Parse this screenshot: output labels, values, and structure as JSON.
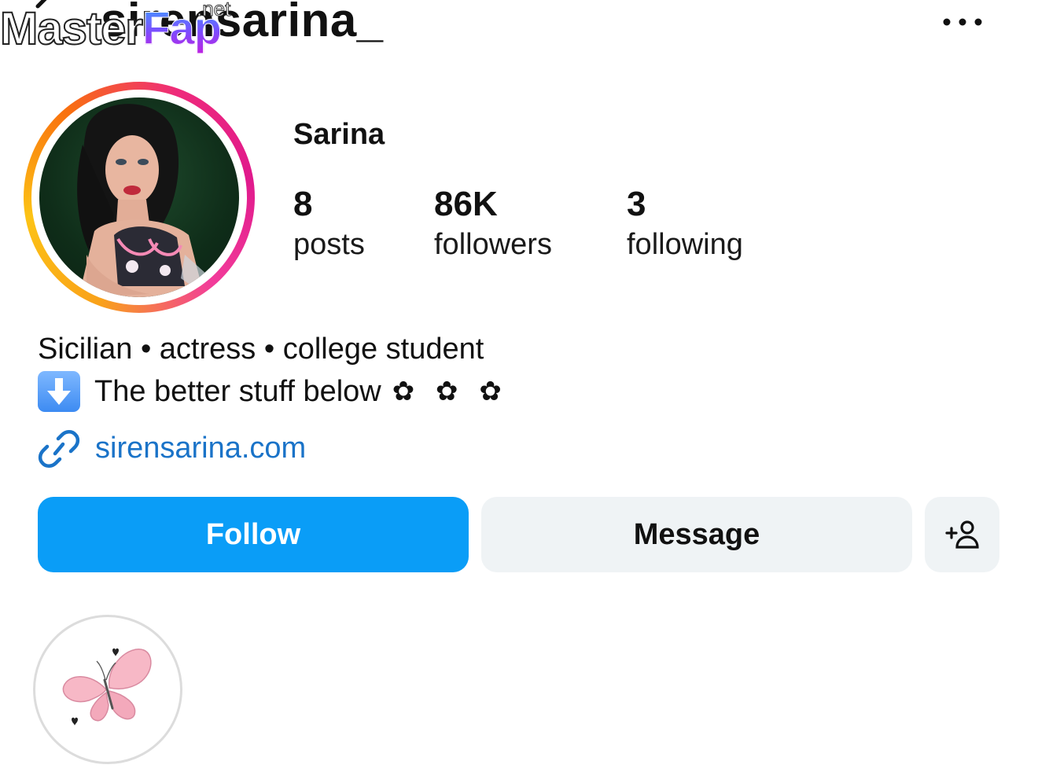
{
  "header": {
    "username": "sirensarina_",
    "watermark_main": "Master",
    "watermark_accent": "Fap",
    "watermark_suffix": ".net",
    "back_icon": "chevron-left-icon",
    "more_icon": "more-horizontal-icon"
  },
  "profile": {
    "display_name": "Sarina",
    "stats": [
      {
        "value": "8",
        "label": "posts"
      },
      {
        "value": "86K",
        "label": "followers"
      },
      {
        "value": "3",
        "label": "following"
      }
    ],
    "ring_colors": [
      "#f9a11a",
      "#fcc315",
      "#f9700e",
      "#ee2a7b",
      "#e0198c"
    ]
  },
  "bio": {
    "line1": "Sicilian • actress • college student",
    "line2": "The better stuff below",
    "line2_emoji": "down-arrow-emoji",
    "line2_flowers": "✿ ✿ ✿",
    "link": "sirensarina.com",
    "link_color": "#1a73c8"
  },
  "actions": {
    "follow_label": "Follow",
    "message_label": "Message",
    "add_user_icon": "add-person-icon",
    "follow_color": "#0a9df7"
  },
  "highlights": [
    {
      "icon": "butterfly-icon"
    }
  ]
}
